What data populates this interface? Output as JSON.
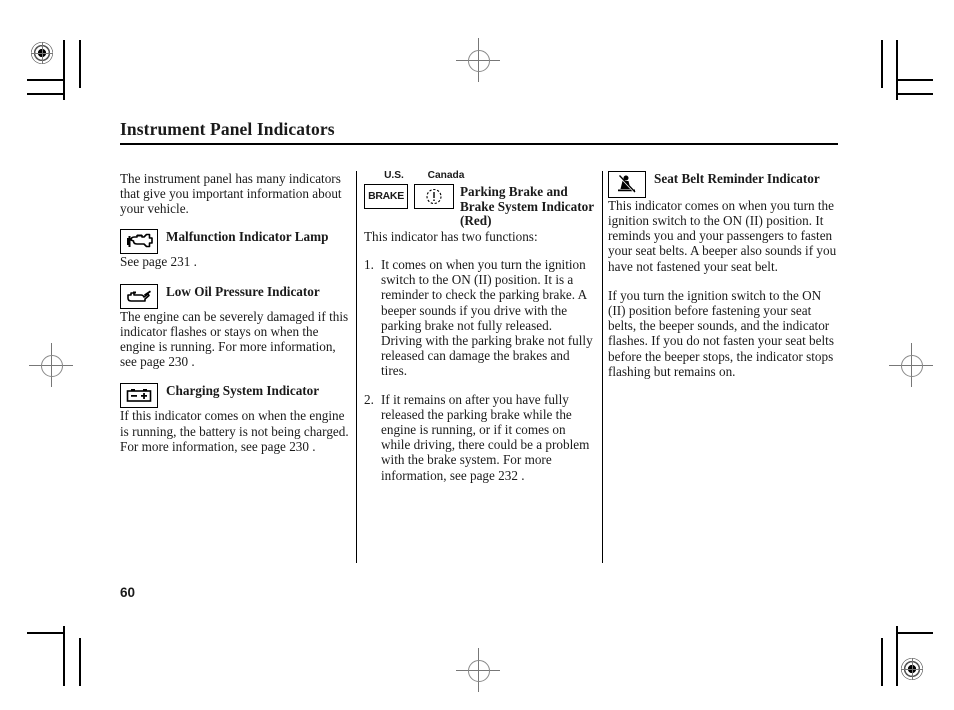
{
  "document": {
    "page_title": "Instrument Panel Indicators",
    "page_number": "60"
  },
  "left_column": {
    "intro": "The instrument panel has many indicators that give you important information about your vehicle.",
    "indicators": [
      {
        "icon": "malfunction-indicator-lamp-icon",
        "title": "Malfunction Indicator Lamp",
        "description": "See page 231 ."
      },
      {
        "icon": "low-oil-pressure-icon",
        "title": "Low Oil Pressure Indicator",
        "description": "The engine can be severely damaged if this indicator flashes or stays on when the engine is running. For more information, see page 230 ."
      },
      {
        "icon": "charging-system-icon",
        "title": "Charging System Indicator",
        "description": "If this indicator comes on when the engine is running, the battery is not being charged. For more information, see page 230 ."
      }
    ]
  },
  "middle_column": {
    "region_labels": {
      "us": "U.S.",
      "canada": "Canada"
    },
    "icons": {
      "us_label": "BRAKE",
      "canada_symbol": "brake-disc-exclamation-icon"
    },
    "title": "Parking Brake and Brake System Indicator (Red)",
    "intro": "This indicator has two functions:",
    "list": [
      {
        "num": "1.",
        "text": "It comes on when you turn the ignition switch to the ON (II) position. It is a reminder to check the parking brake. A beeper sounds if you drive with the parking brake not fully released. Driving with the parking brake not fully released can damage the brakes and tires."
      },
      {
        "num": "2.",
        "text": "If it remains on after you have fully released the parking brake while the engine is running, or if it comes on while driving, there could be a problem with the brake system. For more information, see page 232 ."
      }
    ]
  },
  "right_column": {
    "icon": "seat-belt-reminder-icon",
    "title": "Seat Belt Reminder Indicator",
    "paragraphs": [
      "This indicator comes on when you turn the ignition switch to the ON (II) position. It reminds you and your passengers to fasten your seat belts. A beeper also sounds if you have not fastened your seat belt.",
      "If you turn the ignition switch to the ON (II) position before fastening your seat belts, the beeper sounds, and the indicator flashes. If you do not fasten your seat belts before the beeper stops, the indicator stops flashing but remains on."
    ]
  },
  "colors": {
    "ink": "#1a1a1a",
    "rule": "#000000",
    "paper": "#ffffff",
    "registration_mark": "#777777"
  }
}
